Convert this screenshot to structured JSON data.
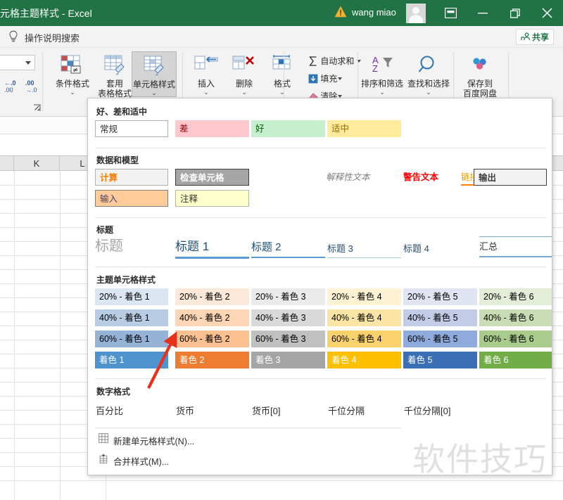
{
  "titlebar": {
    "document_title": "元格主题样式  -  Excel",
    "user_name": "wang miao",
    "warning_icon": "warning-triangle-icon",
    "avatar_icon": "user-avatar-icon",
    "ribbon_display_icon": "ribbon-display-options-icon",
    "minimize_label": "─",
    "maximize_label": "❐",
    "close_label": "✕",
    "accent_color": "#217346"
  },
  "tellme": {
    "icon": "lightbulb-icon",
    "placeholder": "操作说明搜索",
    "share_label": "共享",
    "share_icon": "share-person-icon"
  },
  "ribbon": {
    "numberbox_caret": "chevron-down-icon",
    "decrease_decimal": "减少小数位数",
    "increase_decimal": "增加小数位数",
    "dialog_launcher": "数字格式对话框启动器",
    "buttons": [
      {
        "label": "条件格式",
        "icon": "conditional-formatting-icon",
        "has_caret": true
      },
      {
        "label": "套用\n表格格式",
        "label_line1": "套用",
        "label_line2": "表格格式",
        "icon": "format-as-table-icon",
        "has_caret": true
      },
      {
        "label": "单元格样式",
        "icon": "cell-styles-icon",
        "has_caret": true,
        "selected": true
      },
      {
        "label": "插入",
        "icon": "insert-cells-icon",
        "has_caret": true
      },
      {
        "label": "删除",
        "icon": "delete-cells-icon",
        "has_caret": true
      },
      {
        "label": "格式",
        "icon": "format-cells-icon",
        "has_caret": true
      }
    ],
    "editing": [
      {
        "label": "自动求和",
        "icon": "sigma-icon",
        "has_caret": true
      },
      {
        "label": "填充",
        "icon": "fill-down-icon",
        "has_caret": true
      },
      {
        "label": "清除",
        "icon": "eraser-icon",
        "has_caret": true
      }
    ],
    "sort_filter": {
      "label": "排序和筛选",
      "icon": "sort-filter-icon",
      "has_caret": true
    },
    "find_select": {
      "label": "查找和选择",
      "icon": "magnifier-icon",
      "has_caret": true
    },
    "baidu": {
      "label_line1": "保存到",
      "label_line2": "百度网盘",
      "icon": "baidu-netdisk-icon"
    }
  },
  "sheet": {
    "column_headers": [
      "K",
      "L"
    ],
    "name_box_value": "",
    "formula_value": ""
  },
  "gallery": {
    "sections": [
      {
        "title": "好、差和适中",
        "items": [
          {
            "label": "常规",
            "bg": "#ffffff",
            "fg": "#333333",
            "border": "#b0b0b0"
          },
          {
            "label": "差",
            "bg": "#ffc7ce",
            "fg": "#9c0006",
            "border": ""
          },
          {
            "label": "好",
            "bg": "#c6efce",
            "fg": "#006100",
            "border": ""
          },
          {
            "label": "适中",
            "bg": "#ffeb9c",
            "fg": "#9c6500",
            "border": ""
          }
        ]
      },
      {
        "title": "数据和模型",
        "items": [
          {
            "label": "计算",
            "bg": "#f2f2f2",
            "fg": "#fa7d00",
            "border": "#b0b0b0",
            "bold": true
          },
          {
            "label": "检查单元格",
            "bg": "#a5a5a5",
            "fg": "#ffffff",
            "border": "#3f3f3f",
            "bold": true
          },
          {
            "label": "解释性文本",
            "bg": "#ffffff",
            "fg": "#7f7f7f",
            "border": "",
            "italic": true
          },
          {
            "label": "警告文本",
            "bg": "#ffffff",
            "fg": "#ff0000",
            "border": ""
          },
          {
            "label": "链接单元格",
            "bg": "#ffffff",
            "fg": "#ef9c00",
            "border": "",
            "underline_color": "#ff8001"
          },
          {
            "label": "输出",
            "bg": "#f2f2f2",
            "fg": "#3f3f3f",
            "border": "#3f3f3f",
            "bold": true
          },
          {
            "label": "输入",
            "bg": "#ffcc99",
            "fg": "#3f3f76",
            "border": "#7f7f7f"
          },
          {
            "label": "注释",
            "bg": "#ffffcc",
            "fg": "#333333",
            "border": "#b2b2b2"
          }
        ]
      },
      {
        "title": "标题",
        "items": [
          {
            "label": "标题",
            "fg": "#a5a5a5",
            "size": 20,
            "rule": ""
          },
          {
            "label": "标题 1",
            "fg": "#1f4e78",
            "size": 17,
            "rule": "#5b9bd5",
            "rule_h": 3
          },
          {
            "label": "标题 2",
            "fg": "#1f4e78",
            "size": 15,
            "rule": "#5b9bd5",
            "rule_h": 2
          },
          {
            "label": "标题 3",
            "fg": "#1f4e78",
            "size": 13,
            "rule": "#a5c8e8",
            "rule_h": 1
          },
          {
            "label": "标题 4",
            "fg": "#1f4e78",
            "size": 13,
            "rule": "",
            "rule_h": 0
          },
          {
            "label": "汇总",
            "fg": "#333333",
            "size": 13,
            "rule": "#7fa8cf",
            "rule_h": 2,
            "topline": true
          }
        ]
      },
      {
        "title": "主题单元格样式",
        "rows": [
          [
            {
              "label": "20% - 着色 1",
              "bg": "#dce6f2",
              "fg": "#333333"
            },
            {
              "label": "20% - 着色 2",
              "bg": "#fde9d9",
              "fg": "#333333"
            },
            {
              "label": "20% - 着色 3",
              "bg": "#ebebeb",
              "fg": "#333333"
            },
            {
              "label": "20% - 着色 4",
              "bg": "#fdf2d2",
              "fg": "#333333"
            },
            {
              "label": "20% - 着色 5",
              "bg": "#e0e5f2",
              "fg": "#333333"
            },
            {
              "label": "20% - 着色 6",
              "bg": "#e3eed8",
              "fg": "#333333"
            }
          ],
          [
            {
              "label": "40% - 着色 1",
              "bg": "#b8cce4",
              "fg": "#333333"
            },
            {
              "label": "40% - 着色 2",
              "bg": "#fcd5b4",
              "fg": "#333333"
            },
            {
              "label": "40% - 着色 3",
              "bg": "#d9d9d9",
              "fg": "#333333"
            },
            {
              "label": "40% - 着色 4",
              "bg": "#fbe5a4",
              "fg": "#333333"
            },
            {
              "label": "40% - 着色 5",
              "bg": "#c2cce6",
              "fg": "#333333"
            },
            {
              "label": "40% - 着色 6",
              "bg": "#c9dcb3",
              "fg": "#333333"
            }
          ],
          [
            {
              "label": "60% - 着色 1",
              "bg": "#95b3d7",
              "fg": "#333333"
            },
            {
              "label": "60% - 着色 2",
              "bg": "#fac090",
              "fg": "#333333"
            },
            {
              "label": "60% - 着色 3",
              "bg": "#c0c0c0",
              "fg": "#333333"
            },
            {
              "label": "60% - 着色 4",
              "bg": "#fad26b",
              "fg": "#333333"
            },
            {
              "label": "60% - 着色 5",
              "bg": "#8faadc",
              "fg": "#333333"
            },
            {
              "label": "60% - 着色 6",
              "bg": "#a9cb8c",
              "fg": "#333333"
            }
          ],
          [
            {
              "label": "着色 1",
              "bg": "#4f93ce",
              "fg": "#ffffff"
            },
            {
              "label": "着色 2",
              "bg": "#ed7d31",
              "fg": "#ffffff"
            },
            {
              "label": "着色 3",
              "bg": "#a5a5a5",
              "fg": "#ffffff"
            },
            {
              "label": "着色 4",
              "bg": "#ffc000",
              "fg": "#ffffff"
            },
            {
              "label": "着色 5",
              "bg": "#3a6fb5",
              "fg": "#ffffff"
            },
            {
              "label": "着色 6",
              "bg": "#70ad47",
              "fg": "#ffffff"
            }
          ]
        ]
      },
      {
        "title": "数字格式",
        "items": [
          {
            "label": "百分比"
          },
          {
            "label": "货币"
          },
          {
            "label": "货币[0]"
          },
          {
            "label": "千位分隔"
          },
          {
            "label": "千位分隔[0]"
          }
        ]
      }
    ],
    "menu": [
      {
        "label": "新建单元格样式(N)...",
        "icon": "new-cell-style-icon",
        "accesskey": "N"
      },
      {
        "label": "合并样式(M)...",
        "icon": "merge-styles-icon",
        "accesskey": "M"
      }
    ]
  },
  "annotation": {
    "arrow_color": "#e8301a",
    "arrow_target": "60% - 着色 2"
  },
  "watermark": {
    "text": "软件技巧"
  }
}
